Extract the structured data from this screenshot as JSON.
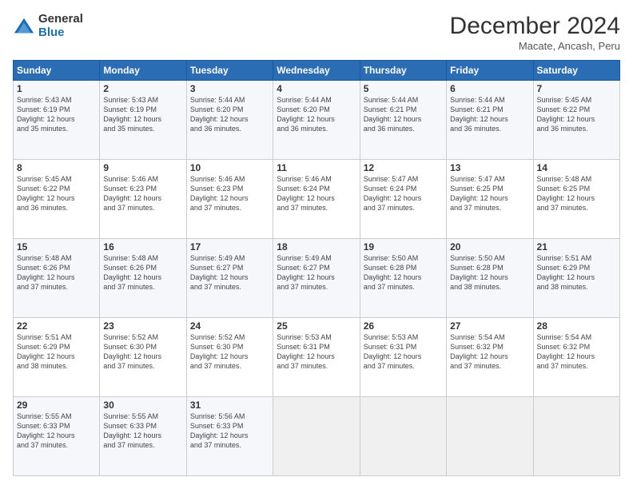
{
  "header": {
    "logo_general": "General",
    "logo_blue": "Blue",
    "month_title": "December 2024",
    "location": "Macate, Ancash, Peru"
  },
  "calendar": {
    "days_header": [
      "Sunday",
      "Monday",
      "Tuesday",
      "Wednesday",
      "Thursday",
      "Friday",
      "Saturday"
    ],
    "weeks": [
      [
        {
          "day": "",
          "info": ""
        },
        {
          "day": "2",
          "info": "Sunrise: 5:43 AM\nSunset: 6:19 PM\nDaylight: 12 hours and 35 minutes."
        },
        {
          "day": "3",
          "info": "Sunrise: 5:44 AM\nSunset: 6:20 PM\nDaylight: 12 hours and 36 minutes."
        },
        {
          "day": "4",
          "info": "Sunrise: 5:44 AM\nSunset: 6:20 PM\nDaylight: 12 hours and 36 minutes."
        },
        {
          "day": "5",
          "info": "Sunrise: 5:44 AM\nSunset: 6:21 PM\nDaylight: 12 hours and 36 minutes."
        },
        {
          "day": "6",
          "info": "Sunrise: 5:44 AM\nSunset: 6:21 PM\nDaylight: 12 hours and 36 minutes."
        },
        {
          "day": "7",
          "info": "Sunrise: 5:45 AM\nSunset: 6:22 PM\nDaylight: 12 hours and 36 minutes."
        }
      ],
      [
        {
          "day": "1",
          "info": "Sunrise: 5:43 AM\nSunset: 6:19 PM\nDaylight: 12 hours and 35 minutes."
        },
        {
          "day": "9",
          "info": "Sunrise: 5:46 AM\nSunset: 6:23 PM\nDaylight: 12 hours and 37 minutes."
        },
        {
          "day": "10",
          "info": "Sunrise: 5:46 AM\nSunset: 6:23 PM\nDaylight: 12 hours and 37 minutes."
        },
        {
          "day": "11",
          "info": "Sunrise: 5:46 AM\nSunset: 6:24 PM\nDaylight: 12 hours and 37 minutes."
        },
        {
          "day": "12",
          "info": "Sunrise: 5:47 AM\nSunset: 6:24 PM\nDaylight: 12 hours and 37 minutes."
        },
        {
          "day": "13",
          "info": "Sunrise: 5:47 AM\nSunset: 6:25 PM\nDaylight: 12 hours and 37 minutes."
        },
        {
          "day": "14",
          "info": "Sunrise: 5:48 AM\nSunset: 6:25 PM\nDaylight: 12 hours and 37 minutes."
        }
      ],
      [
        {
          "day": "8",
          "info": "Sunrise: 5:45 AM\nSunset: 6:22 PM\nDaylight: 12 hours and 36 minutes."
        },
        {
          "day": "16",
          "info": "Sunrise: 5:48 AM\nSunset: 6:26 PM\nDaylight: 12 hours and 37 minutes."
        },
        {
          "day": "17",
          "info": "Sunrise: 5:49 AM\nSunset: 6:27 PM\nDaylight: 12 hours and 37 minutes."
        },
        {
          "day": "18",
          "info": "Sunrise: 5:49 AM\nSunset: 6:27 PM\nDaylight: 12 hours and 37 minutes."
        },
        {
          "day": "19",
          "info": "Sunrise: 5:50 AM\nSunset: 6:28 PM\nDaylight: 12 hours and 37 minutes."
        },
        {
          "day": "20",
          "info": "Sunrise: 5:50 AM\nSunset: 6:28 PM\nDaylight: 12 hours and 38 minutes."
        },
        {
          "day": "21",
          "info": "Sunrise: 5:51 AM\nSunset: 6:29 PM\nDaylight: 12 hours and 38 minutes."
        }
      ],
      [
        {
          "day": "15",
          "info": "Sunrise: 5:48 AM\nSunset: 6:26 PM\nDaylight: 12 hours and 37 minutes."
        },
        {
          "day": "23",
          "info": "Sunrise: 5:52 AM\nSunset: 6:30 PM\nDaylight: 12 hours and 37 minutes."
        },
        {
          "day": "24",
          "info": "Sunrise: 5:52 AM\nSunset: 6:30 PM\nDaylight: 12 hours and 37 minutes."
        },
        {
          "day": "25",
          "info": "Sunrise: 5:53 AM\nSunset: 6:31 PM\nDaylight: 12 hours and 37 minutes."
        },
        {
          "day": "26",
          "info": "Sunrise: 5:53 AM\nSunset: 6:31 PM\nDaylight: 12 hours and 37 minutes."
        },
        {
          "day": "27",
          "info": "Sunrise: 5:54 AM\nSunset: 6:32 PM\nDaylight: 12 hours and 37 minutes."
        },
        {
          "day": "28",
          "info": "Sunrise: 5:54 AM\nSunset: 6:32 PM\nDaylight: 12 hours and 37 minutes."
        }
      ],
      [
        {
          "day": "22",
          "info": "Sunrise: 5:51 AM\nSunset: 6:29 PM\nDaylight: 12 hours and 38 minutes."
        },
        {
          "day": "30",
          "info": "Sunrise: 5:55 AM\nSunset: 6:33 PM\nDaylight: 12 hours and 37 minutes."
        },
        {
          "day": "31",
          "info": "Sunrise: 5:56 AM\nSunset: 6:33 PM\nDaylight: 12 hours and 37 minutes."
        },
        {
          "day": "",
          "info": ""
        },
        {
          "day": "",
          "info": ""
        },
        {
          "day": "",
          "info": ""
        },
        {
          "day": "",
          "info": ""
        }
      ],
      [
        {
          "day": "29",
          "info": "Sunrise: 5:55 AM\nSunset: 6:33 PM\nDaylight: 12 hours and 37 minutes."
        },
        {
          "day": "",
          "info": ""
        },
        {
          "day": "",
          "info": ""
        },
        {
          "day": "",
          "info": ""
        },
        {
          "day": "",
          "info": ""
        },
        {
          "day": "",
          "info": ""
        },
        {
          "day": "",
          "info": ""
        }
      ]
    ]
  }
}
